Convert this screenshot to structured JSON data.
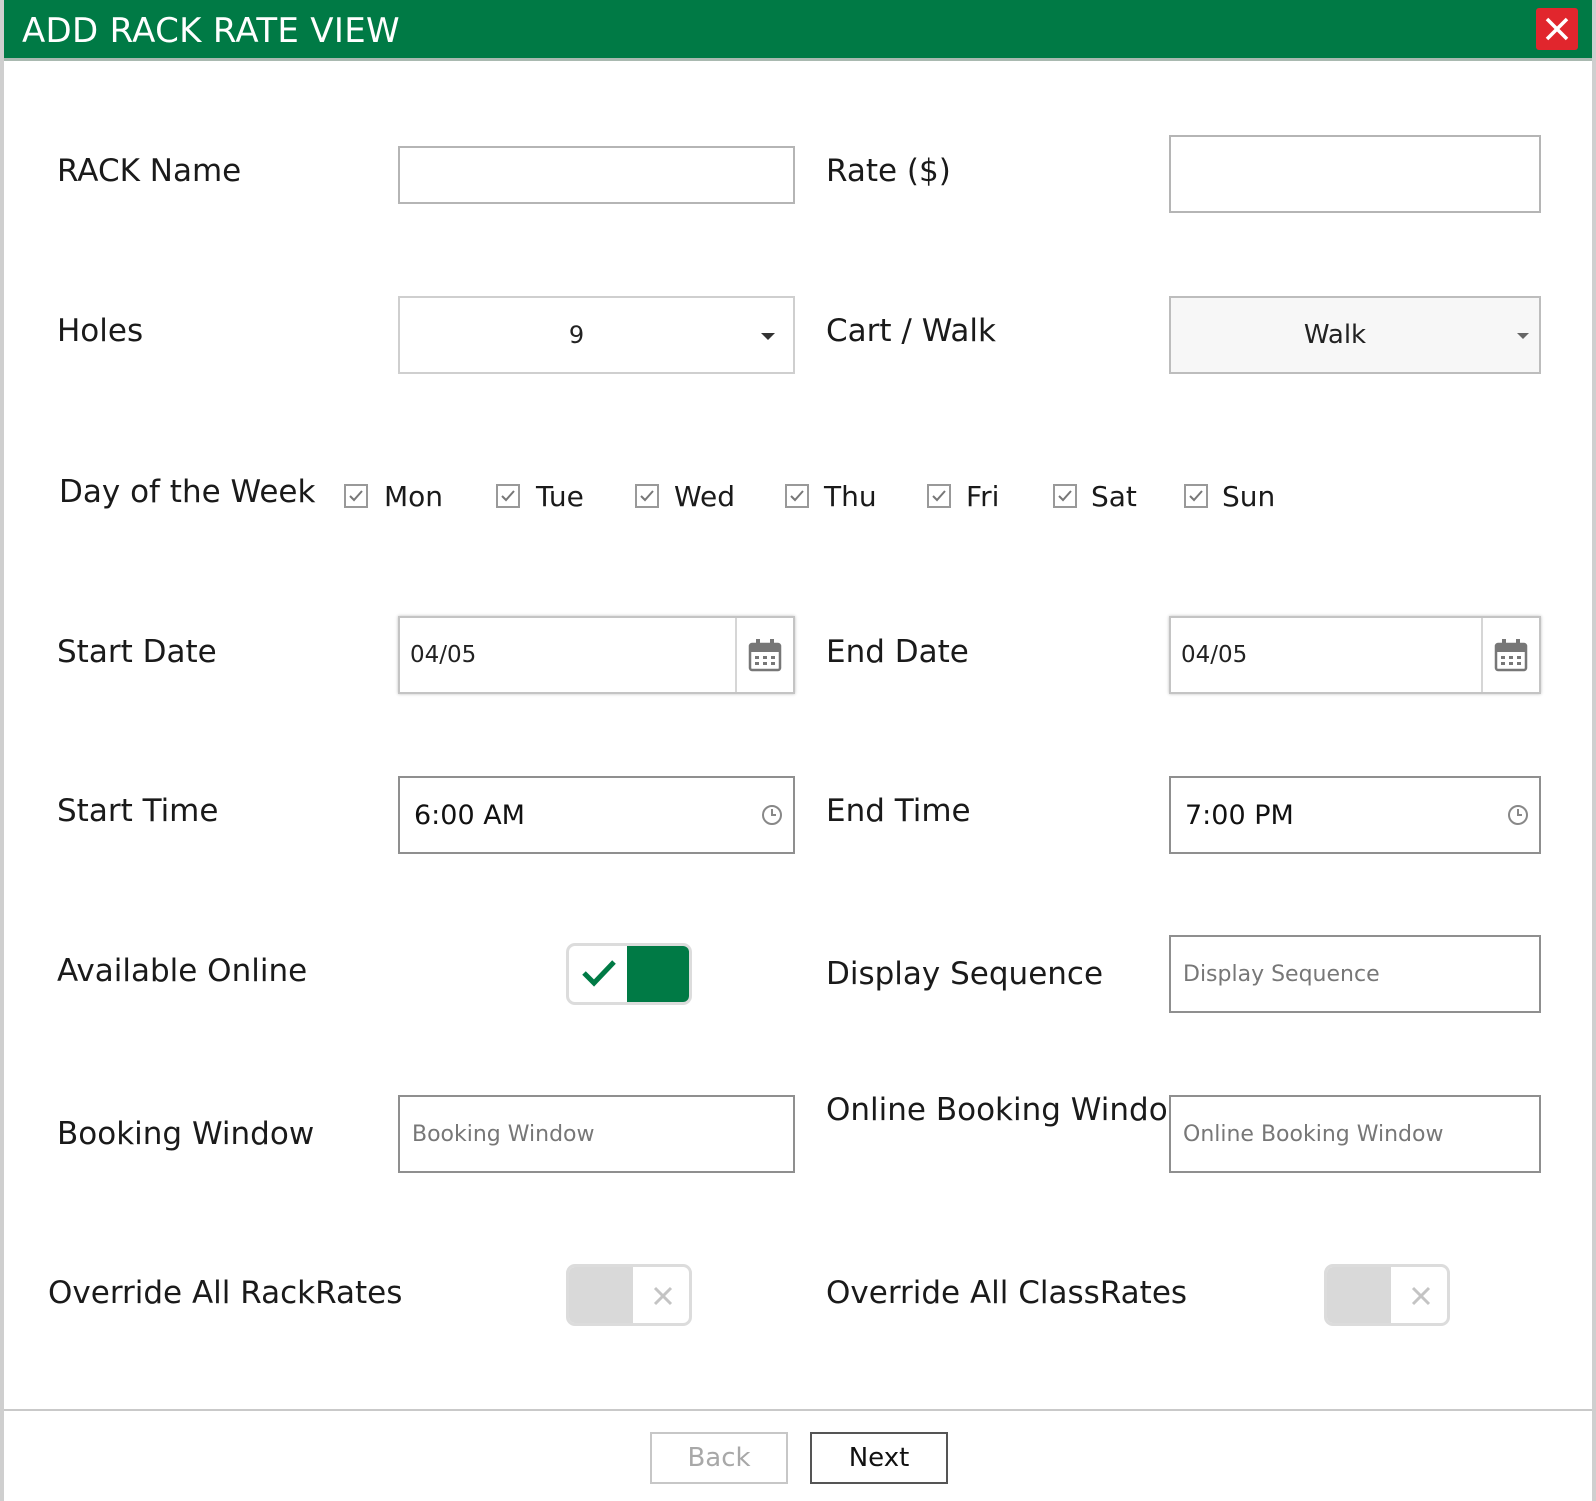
{
  "dialog": {
    "title": "ADD RACK RATE VIEW",
    "accent_color": "#007a45",
    "close_color": "#e1262d"
  },
  "form": {
    "rack_name": {
      "label": "RACK Name",
      "value": ""
    },
    "rate": {
      "label": "Rate ($)",
      "value": ""
    },
    "holes": {
      "label": "Holes",
      "value": "9"
    },
    "cart_walk": {
      "label": "Cart / Walk",
      "value": "Walk"
    },
    "day_of_week": {
      "label": "Day of the Week",
      "days": [
        {
          "label": "Mon",
          "checked": true
        },
        {
          "label": "Tue",
          "checked": true
        },
        {
          "label": "Wed",
          "checked": true
        },
        {
          "label": "Thu",
          "checked": true
        },
        {
          "label": "Fri",
          "checked": true
        },
        {
          "label": "Sat",
          "checked": true
        },
        {
          "label": "Sun",
          "checked": true
        }
      ]
    },
    "start_date": {
      "label": "Start Date",
      "value": "04/05"
    },
    "end_date": {
      "label": "End Date",
      "value": "04/05"
    },
    "start_time": {
      "label": "Start Time",
      "value": "6:00 AM"
    },
    "end_time": {
      "label": "End Time",
      "value": "7:00 PM"
    },
    "available_online": {
      "label": "Available Online",
      "on": true
    },
    "display_sequence": {
      "label": "Display Sequence",
      "placeholder": "Display Sequence",
      "value": ""
    },
    "booking_window": {
      "label": "Booking Window",
      "placeholder": "Booking Window",
      "value": ""
    },
    "online_booking_window": {
      "label": "Online Booking Window",
      "placeholder": "Online Booking Window",
      "value": ""
    },
    "override_rackrates": {
      "label": "Override All RackRates",
      "on": false
    },
    "override_classrates": {
      "label": "Override All ClassRates",
      "on": false
    }
  },
  "footer": {
    "back_label": "Back",
    "next_label": "Next"
  }
}
